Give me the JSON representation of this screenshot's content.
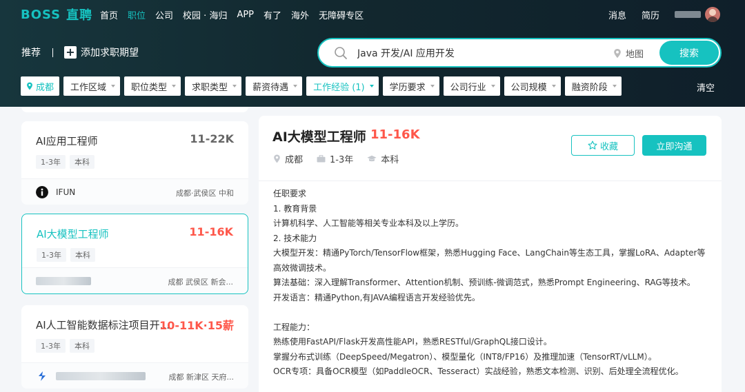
{
  "header": {
    "logo_en": "BOSS",
    "logo_cn": "直聘",
    "nav": [
      "首页",
      "职位",
      "公司",
      "校园 · 海归",
      "APP",
      "有了",
      "海外",
      "无障碍专区"
    ],
    "nav_active": "职位",
    "messages": "消息",
    "resume": "简历"
  },
  "subbar": {
    "recommend": "推荐",
    "add_label": "添加求职期望"
  },
  "search": {
    "value": "Java 开发/AI 应用开发",
    "map_label": "地图",
    "button": "搜索"
  },
  "filters": {
    "city": "成都",
    "items": [
      "工作区域",
      "职位类型",
      "求职类型",
      "薪资待遇",
      "工作经验 (1)",
      "学历要求",
      "公司行业",
      "公司规模",
      "融资阶段"
    ],
    "active": "工作经验 (1)",
    "clear": "清空"
  },
  "jobs": [
    {
      "title": "AI应用工程师",
      "salary": "11-22K",
      "tags": [
        "1-3年",
        "本科"
      ],
      "company": "IFUN",
      "location": "成都·武侯区 中和"
    },
    {
      "title": "AI大模型工程师",
      "salary": "11-16K",
      "tags": [
        "1-3年",
        "本科"
      ],
      "company": "",
      "location": "成都 武侯区 新会..."
    },
    {
      "title": "AI人工智能数据标注项目开...",
      "salary": "10-11K·15薪",
      "tags": [
        "1-3年",
        "本科"
      ],
      "company": "",
      "location": "成都 新津区 天府..."
    }
  ],
  "detail": {
    "title": "AI大模型工程师",
    "salary": "11-16K",
    "city": "成都",
    "experience": "1-3年",
    "degree": "本科",
    "fav_label": "收藏",
    "chat_label": "立即沟通",
    "lines": [
      "任职要求",
      "1. 教育背景",
      "计算机科学、人工智能等相关专业本科及以上学历。",
      "2. 技术能力",
      "大模型开发：精通PyTorch/TensorFlow框架，熟悉Hugging Face、LangChain等生态工具，掌握LoRA、Adapter等",
      "高效微调技术。",
      "算法基础：深入理解Transformer、Attention机制、预训练-微调范式，熟悉Prompt Engineering、RAG等技术。",
      "开发语言：精通Python,有JAVA编程语言开发经验优先。",
      "",
      "工程能力：",
      "熟练使用FastAPI/Flask开发高性能API，熟悉RESTful/GraphQL接口设计。",
      "掌握分布式训练（DeepSpeed/Megatron）、模型量化（INT8/FP16）及推理加速（TensorRT/vLLM）。",
      "OCR专项：具备OCR模型（如PaddleOCR、Tesseract）实战经验，熟悉文本检测、识别、后处理全流程优化。"
    ]
  },
  "colors": {
    "accent": "#16c2c0",
    "salary": "#fe574a",
    "header_bg": "#12282f"
  }
}
